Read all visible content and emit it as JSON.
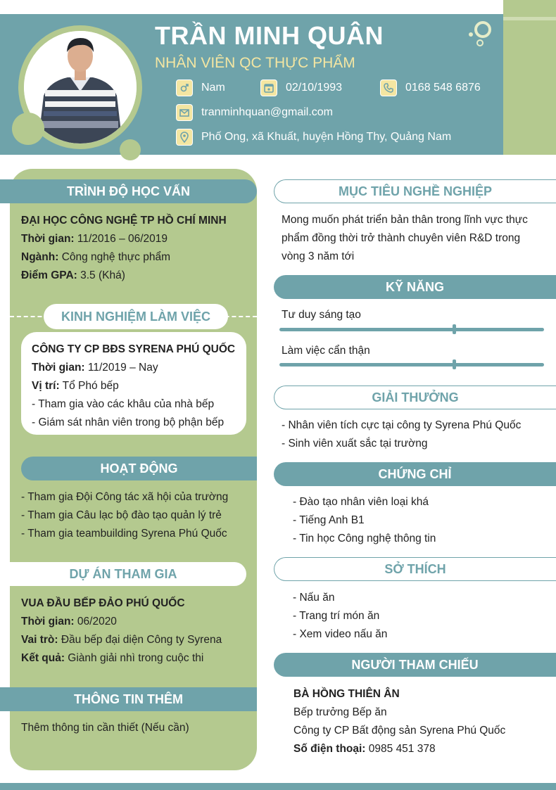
{
  "header": {
    "name": "TRẦN MINH QUÂN",
    "job_title": "NHÂN VIÊN QC THỰC PHẨM",
    "gender": "Nam",
    "birthday": "02/10/1993",
    "phone": "0168 548 6876",
    "email": "tranminhquan@gmail.com",
    "address": "Phố Ong, xã Khuất, huyện Hồng Thy, Quảng Nam"
  },
  "education": {
    "heading": "TRÌNH ĐỘ HỌC VẤN",
    "school": "ĐẠI HỌC CÔNG NGHỆ TP HỒ CHÍ MINH",
    "time_label": "Thời gian:",
    "time_value": " 11/2016 – 06/2019",
    "major_label": "Ngành:",
    "major_value": " Công nghệ thực phẩm",
    "gpa_label": "Điểm GPA:",
    "gpa_value": " 3.5 (Khá)"
  },
  "experience": {
    "heading": "KINH NGHIỆM LÀM VIỆC",
    "company": "CÔNG TY CP BĐS SYRENA PHÚ QUỐC",
    "time_label": "Thời gian:",
    "time_value": " 11/2019 – Nay",
    "position_label": "Vị trí:",
    "position_value": " Tổ Phó bếp",
    "bullets": [
      "- Tham gia vào các khâu của nhà bếp",
      "- Giám sát nhân viên trong bộ phận bếp"
    ]
  },
  "activities": {
    "heading": "HOẠT ĐỘNG",
    "items": [
      "- Tham gia Đội Công tác xã hội của trường",
      "- Tham gia Câu lạc bộ đào tạo quản lý trẻ",
      "- Tham gia teambuilding Syrena Phú Quốc"
    ]
  },
  "projects": {
    "heading": "DỰ ÁN THAM GIA",
    "name": "VUA ĐẦU BẾP ĐẢO PHÚ QUỐC",
    "time_label": "Thời gian:",
    "time_value": " 06/2020",
    "role_label": "Vai trò:",
    "role_value": " Đầu bếp đại diện Công ty Syrena",
    "result_label": "Kết quả:",
    "result_value": " Giành giải nhì trong cuộc thi"
  },
  "additional": {
    "heading": "THÔNG TIN THÊM",
    "text": "Thêm thông tin cần thiết (Nếu cần)"
  },
  "objective": {
    "heading": "MỤC TIÊU NGHỀ NGHIỆP",
    "lines": [
      "Mong muốn phát triển bản thân trong lĩnh vực thực",
      "phẩm đồng thời trở thành chuyên viên R&D trong",
      "vòng 3 năm tới"
    ]
  },
  "skills": {
    "heading": "KỸ NĂNG",
    "items": [
      {
        "name": "Tư duy sáng tạo",
        "level": 0.66
      },
      {
        "name": "Làm việc cẩn thận",
        "level": 0.66
      }
    ]
  },
  "awards": {
    "heading": "GIẢI THƯỞNG",
    "items": [
      "- Nhân viên tích cực tại công ty Syrena Phú Quốc",
      "- Sinh viên xuất sắc tại trường"
    ]
  },
  "certificates": {
    "heading": "CHỨNG CHỈ",
    "items": [
      "- Đào tạo nhân viên loại khá",
      "- Tiếng Anh B1",
      "- Tin học Công nghệ thông tin"
    ]
  },
  "hobbies": {
    "heading": "SỞ THÍCH",
    "items": [
      "- Nấu ăn",
      "- Trang trí món ăn",
      "- Xem video nấu ăn"
    ]
  },
  "reference": {
    "heading": "NGƯỜI THAM CHIẾU",
    "name": "BÀ HỒNG THIÊN ÂN",
    "title": "Bếp trưởng Bếp ăn",
    "company": "Công ty CP Bất động sản Syrena Phú Quốc",
    "phone_label": "Số điện thoại:",
    "phone_value": " 0985 451 378"
  },
  "colors": {
    "teal": "#6fa3aa",
    "green": "#b4c98f",
    "yellow": "#f4e6a2"
  }
}
